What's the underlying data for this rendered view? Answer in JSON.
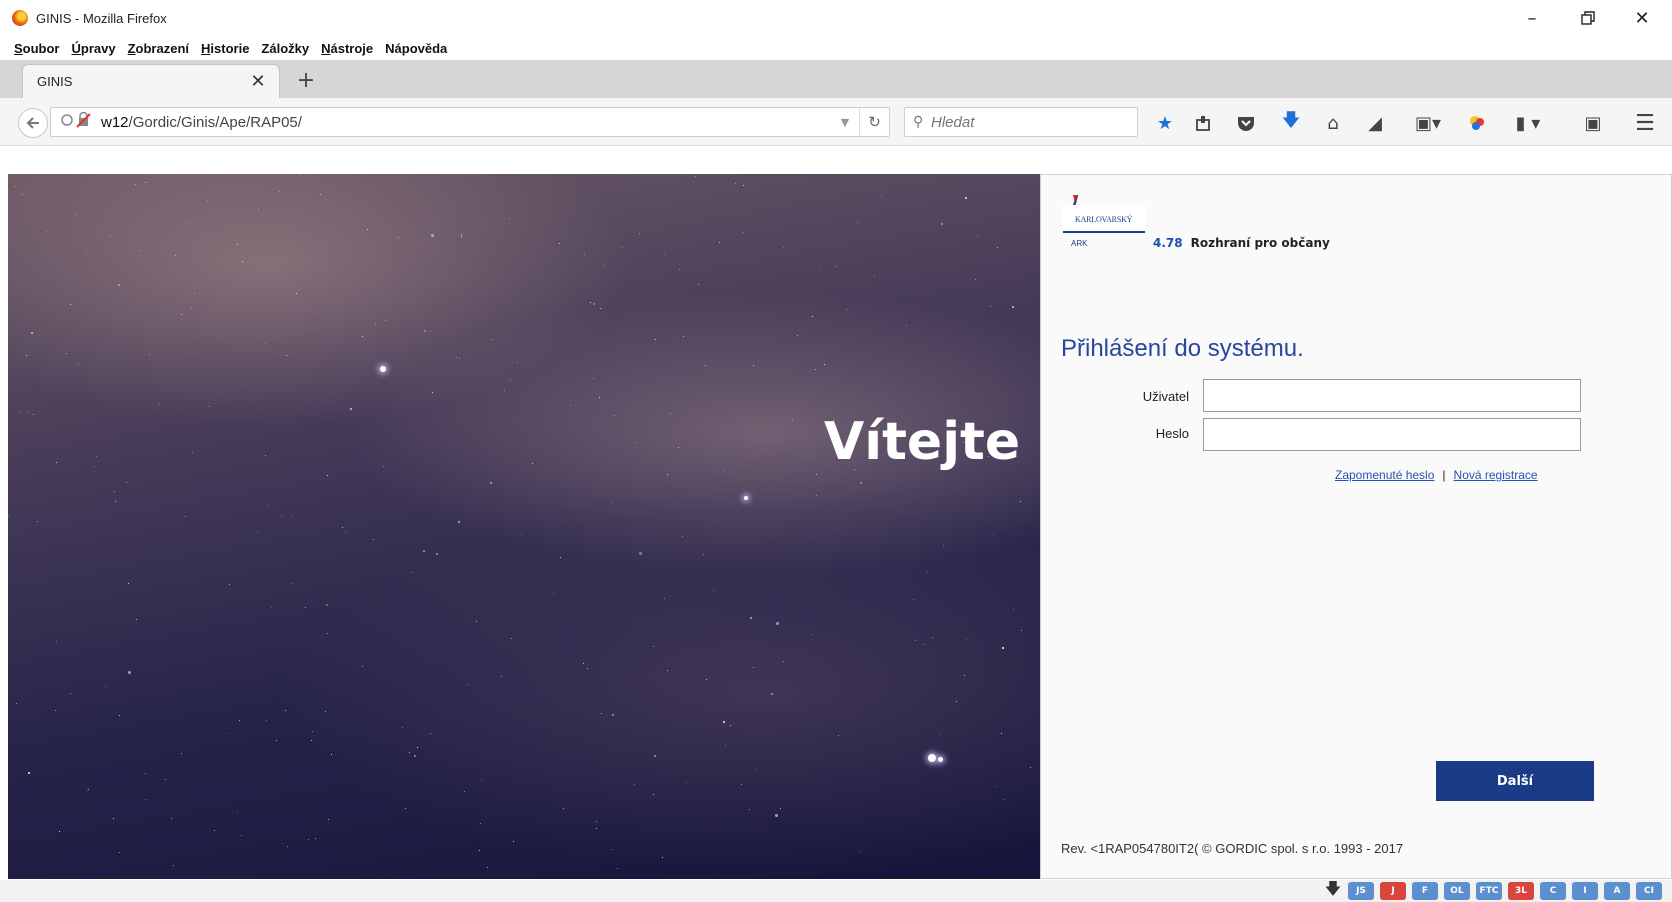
{
  "window": {
    "title": "GINIS - Mozilla Firefox"
  },
  "menu": [
    {
      "acc": "S",
      "rest": "oubor"
    },
    {
      "acc": "Ú",
      "rest": "pravy"
    },
    {
      "acc": "Z",
      "rest": "obrazení"
    },
    {
      "acc": "H",
      "rest": "istorie"
    },
    {
      "acc": "",
      "rest": "Záložky"
    },
    {
      "acc": "N",
      "rest": "ástroje"
    },
    {
      "acc": "",
      "rest": "Nápověda"
    }
  ],
  "tab": {
    "label": "GINIS"
  },
  "navbar": {
    "url_host": "w12",
    "url_path": "/Gordic/Ginis/Ape/RAP05/",
    "search_placeholder": "Hledat"
  },
  "page": {
    "welcome": "Vítejte",
    "logo": {
      "brand": "KARLOVARSKÝ",
      "sub": "ARK"
    },
    "version": "4.78",
    "interface_label": "Rozhraní pro občany",
    "login_title": "Přihlášení do systému.",
    "username_label": "Uživatel",
    "password_label": "Heslo",
    "forgot_password": "Zapomenuté heslo",
    "new_registration": "Nová registrace",
    "next_button": "Další",
    "revision": "Rev. <1RAP054780IT2( © GORDIC spol. s r.o. 1993 - 2017"
  },
  "statusbar": {
    "badges": [
      {
        "label": "JS",
        "color": "#5b8fd0"
      },
      {
        "label": "J",
        "color": "#d9453a"
      },
      {
        "label": "F",
        "color": "#5b8fd0"
      },
      {
        "label": "OL",
        "color": "#5b8fd0"
      },
      {
        "label": "FTC",
        "color": "#5b8fd0"
      },
      {
        "label": "3L",
        "color": "#d9453a"
      },
      {
        "label": "C",
        "color": "#5b8fd0"
      },
      {
        "label": "I",
        "color": "#5b8fd0"
      },
      {
        "label": "A",
        "color": "#5b8fd0"
      },
      {
        "label": "CI",
        "color": "#5b8fd0"
      }
    ]
  },
  "colors": {
    "brand_blue": "#1c3b86",
    "title_blue": "#28469e",
    "link_blue": "#2852b5"
  }
}
